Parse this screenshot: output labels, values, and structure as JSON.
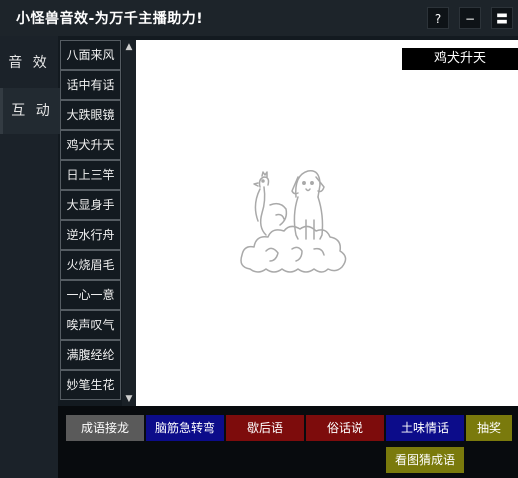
{
  "title": "小怪兽音效-为万千主播助力!",
  "titlebar_buttons": {
    "help": "?",
    "minimize": "−",
    "menu": "〓"
  },
  "side_tabs": [
    {
      "label": "音 效",
      "active": false
    },
    {
      "label": "互 动",
      "active": true
    }
  ],
  "words": [
    "八面来风",
    "话中有话",
    "大跌眼镜",
    "鸡犬升天",
    "日上三竿",
    "大显身手",
    "逆水行舟",
    "火烧眉毛",
    "一心一意",
    "唉声叹气",
    "满腹经纶",
    "妙笔生花"
  ],
  "scrollbar": {
    "up": "▲",
    "down": "▼"
  },
  "current_word": "鸡犬升天",
  "categories": [
    {
      "label": "成语接龙",
      "color": "#5a5a5a"
    },
    {
      "label": "脑筋急转弯",
      "color": "#0c0c8a"
    },
    {
      "label": "歇后语",
      "color": "#7d0c0c"
    },
    {
      "label": "俗话说",
      "color": "#7d0c0c"
    },
    {
      "label": "土味情话",
      "color": "#0c0c8a"
    },
    {
      "label": "抽奖",
      "color": "#7a7a0c"
    },
    {
      "label": "看图猜成语",
      "color": "#7a7a0c"
    }
  ]
}
